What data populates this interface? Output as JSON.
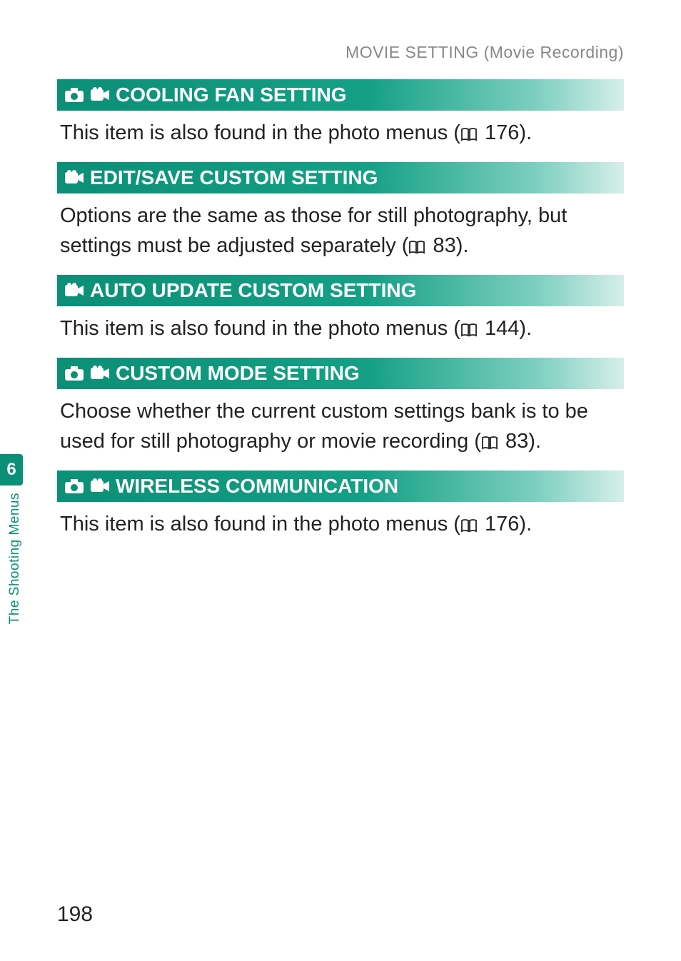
{
  "breadcrumb": "MOVIE SETTING (Movie Recording)",
  "sections": [
    {
      "icons": [
        "camera",
        "movie"
      ],
      "title": "COOLING FAN SETTING",
      "body_pre": "This item is also found in the photo menus (",
      "body_ref": " 176).",
      "body_post": ""
    },
    {
      "icons": [
        "movie"
      ],
      "title": "EDIT/SAVE CUSTOM SETTING",
      "body_pre": "Options are the same as those for still photography, but settings must be adjusted separately (",
      "body_ref": " 83).",
      "body_post": ""
    },
    {
      "icons": [
        "movie"
      ],
      "title": "AUTO UPDATE CUSTOM SETTING",
      "body_pre": "This item is also found in the photo menus (",
      "body_ref": " 144).",
      "body_post": ""
    },
    {
      "icons": [
        "camera",
        "movie"
      ],
      "title": "CUSTOM MODE SETTING",
      "body_pre": "Choose whether the current custom settings bank is to be used for still photography or movie recording (",
      "body_ref": " 83).",
      "body_post": ""
    },
    {
      "icons": [
        "camera",
        "movie"
      ],
      "title": "WIRELESS COMMUNICATION",
      "body_pre": "This item is also found in the photo menus (",
      "body_ref": " 176).",
      "body_post": ""
    }
  ],
  "side_tab": "6",
  "side_label": "The Shooting Menus",
  "page_num": "198"
}
